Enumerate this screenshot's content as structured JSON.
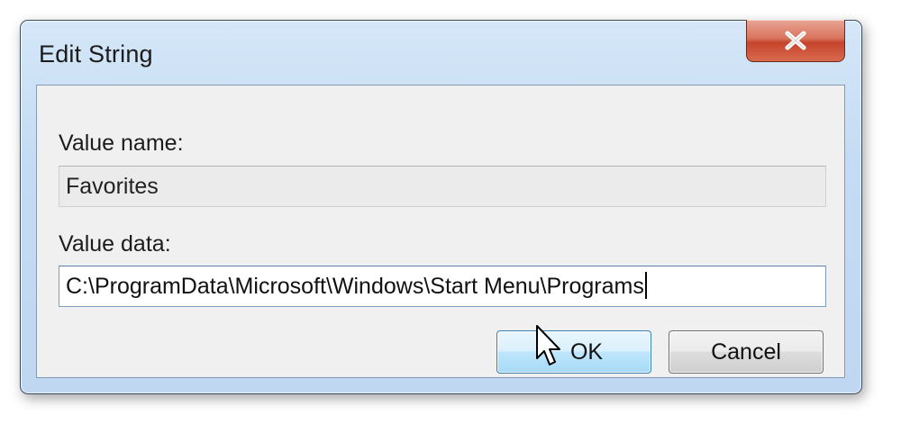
{
  "window": {
    "title": "Edit String"
  },
  "icons": {
    "close": "close-icon",
    "cursor": "mouse-pointer-icon"
  },
  "form": {
    "value_name_label": "Value name:",
    "value_name": "Favorites",
    "value_data_label": "Value data:",
    "value_data": "C:\\ProgramData\\Microsoft\\Windows\\Start Menu\\Programs"
  },
  "buttons": {
    "ok_label": "OK",
    "cancel_label": "Cancel"
  },
  "colors": {
    "close_button": "#c5442b",
    "ok_button_border": "#3c7fb1",
    "window_frame": "#c3dbf3"
  }
}
